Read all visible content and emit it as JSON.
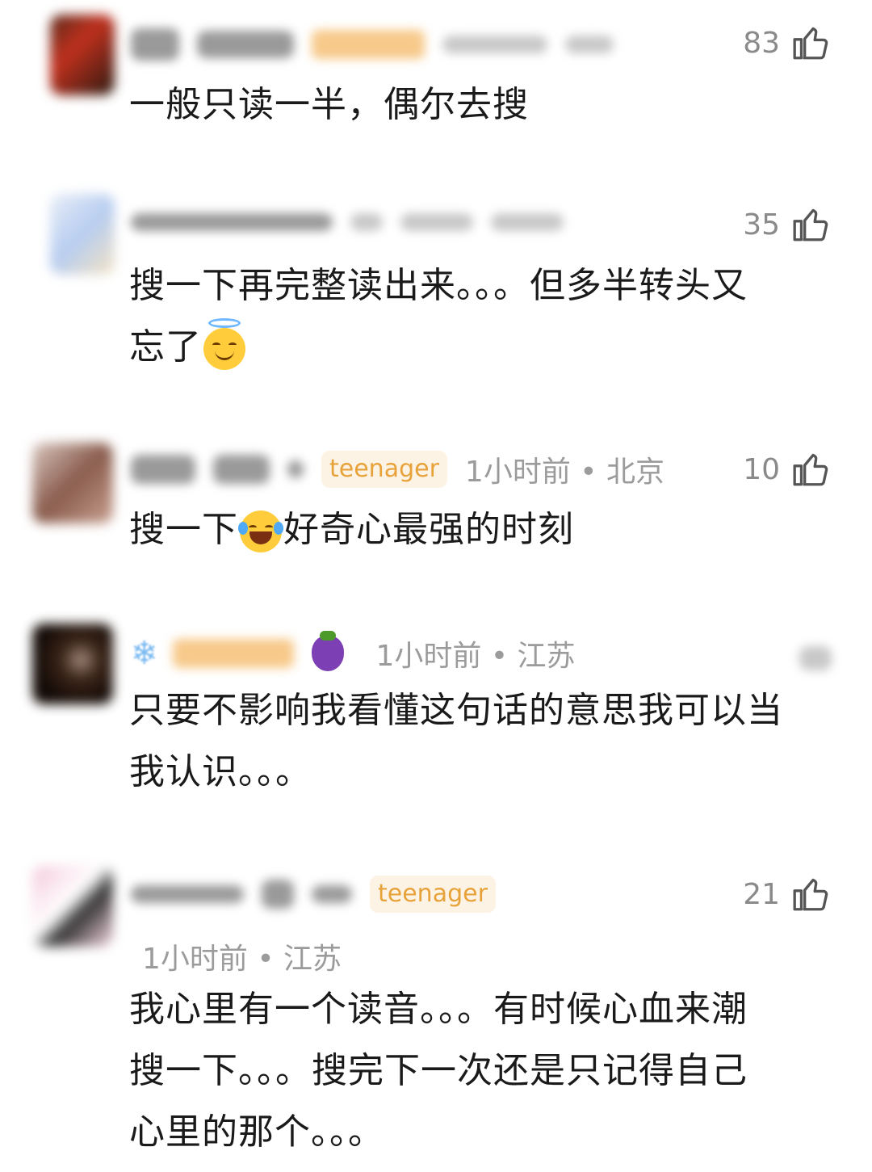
{
  "comments": [
    {
      "likes": "83",
      "text": "一般只读一半，偶尔去搜"
    },
    {
      "likes": "35",
      "text_line1": "搜一下再完整读出来。。。但多半转头又",
      "text_line2": "忘了",
      "emoji": "smiling-face-with-halo-emoji"
    },
    {
      "badge": "teenager",
      "time_location": "1小时前 • 北京",
      "likes": "10",
      "text_before": "搜一下",
      "emoji": "face-with-tears-of-joy-emoji",
      "text_after": "好奇心最强的时刻"
    },
    {
      "time_location": "1小时前 • 江苏",
      "text_line1": "只要不影响我看懂这句话的意思我可以当",
      "text_line2": "我认识。。。",
      "icons": [
        "snowflake-icon",
        "eggplant-icon"
      ]
    },
    {
      "badge": "teenager",
      "time_location": "1小时前 • 江苏",
      "likes": "21",
      "text_line1": "我心里有一个读音。。。有时候心血来潮",
      "text_line2": "搜一下。。。搜完下一次还是只记得自己",
      "text_line3": "心里的那个。。。"
    }
  ],
  "colors": {
    "badge_text": "#e8a23a",
    "badge_bg": "#fdf3e4",
    "meta_text": "#9b9b9b",
    "body_text": "#1a1a1a"
  }
}
